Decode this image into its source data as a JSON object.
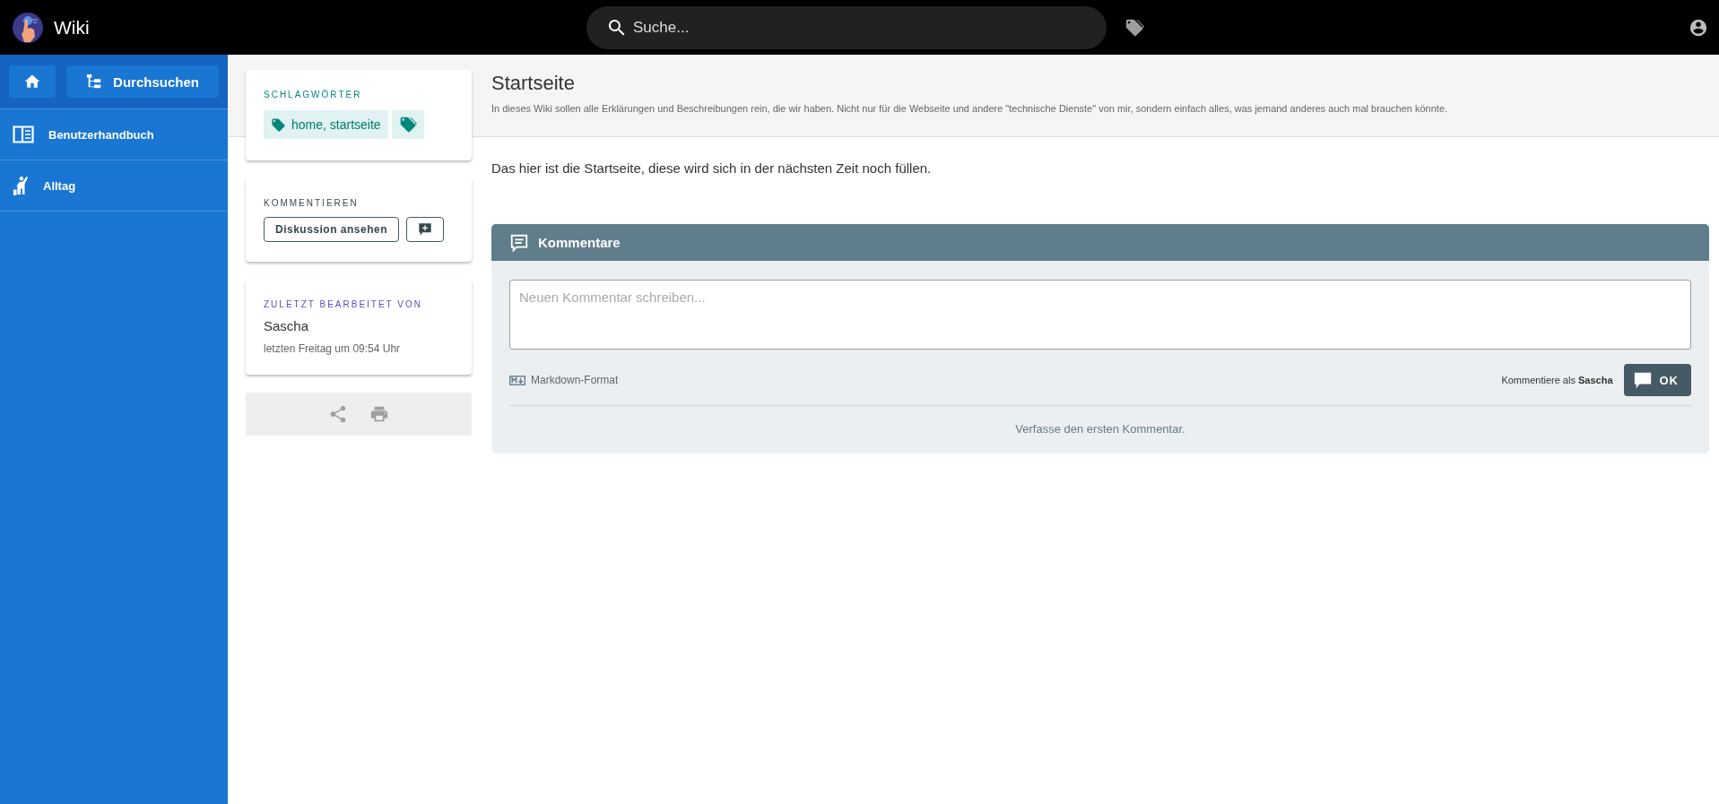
{
  "app": {
    "title": "Wiki"
  },
  "search": {
    "placeholder": "Suche..."
  },
  "sidebar": {
    "browse_button": "Durchsuchen",
    "items": [
      {
        "label": "Benutzerhandbuch",
        "kind": "book"
      },
      {
        "label": "Alltag",
        "kind": "person"
      }
    ]
  },
  "tags_card": {
    "heading": "SCHLAGWÖRTER",
    "tags": [
      "home, startseite"
    ]
  },
  "comment_card": {
    "heading": "KOMMENTIEREN",
    "button": "Diskussion ansehen"
  },
  "edited_card": {
    "heading": "ZULETZT BEARBEITET VON",
    "name": "Sascha",
    "time": "letzten Freitag um 09:54 Uhr"
  },
  "page": {
    "title": "Startseite",
    "description": "In dieses Wiki sollen alle Erklärungen und Beschreibungen rein, die wir haben. Nicht nur für die Webseite und andere \"technische Dienste\" von mir, sondern einfach alles, was jemand anderes auch mal brauchen könnte.",
    "content": "Das hier ist die Startseite, diese wird sich in der nächsten Zeit noch füllen."
  },
  "comments": {
    "title": "Kommentare",
    "placeholder": "Neuen Kommentar schreiben...",
    "format": "Markdown-Format",
    "comment_as": "Kommentiere als **Sascha**",
    "submit": "OK",
    "empty": "Verfasse den ersten Kommentar."
  }
}
